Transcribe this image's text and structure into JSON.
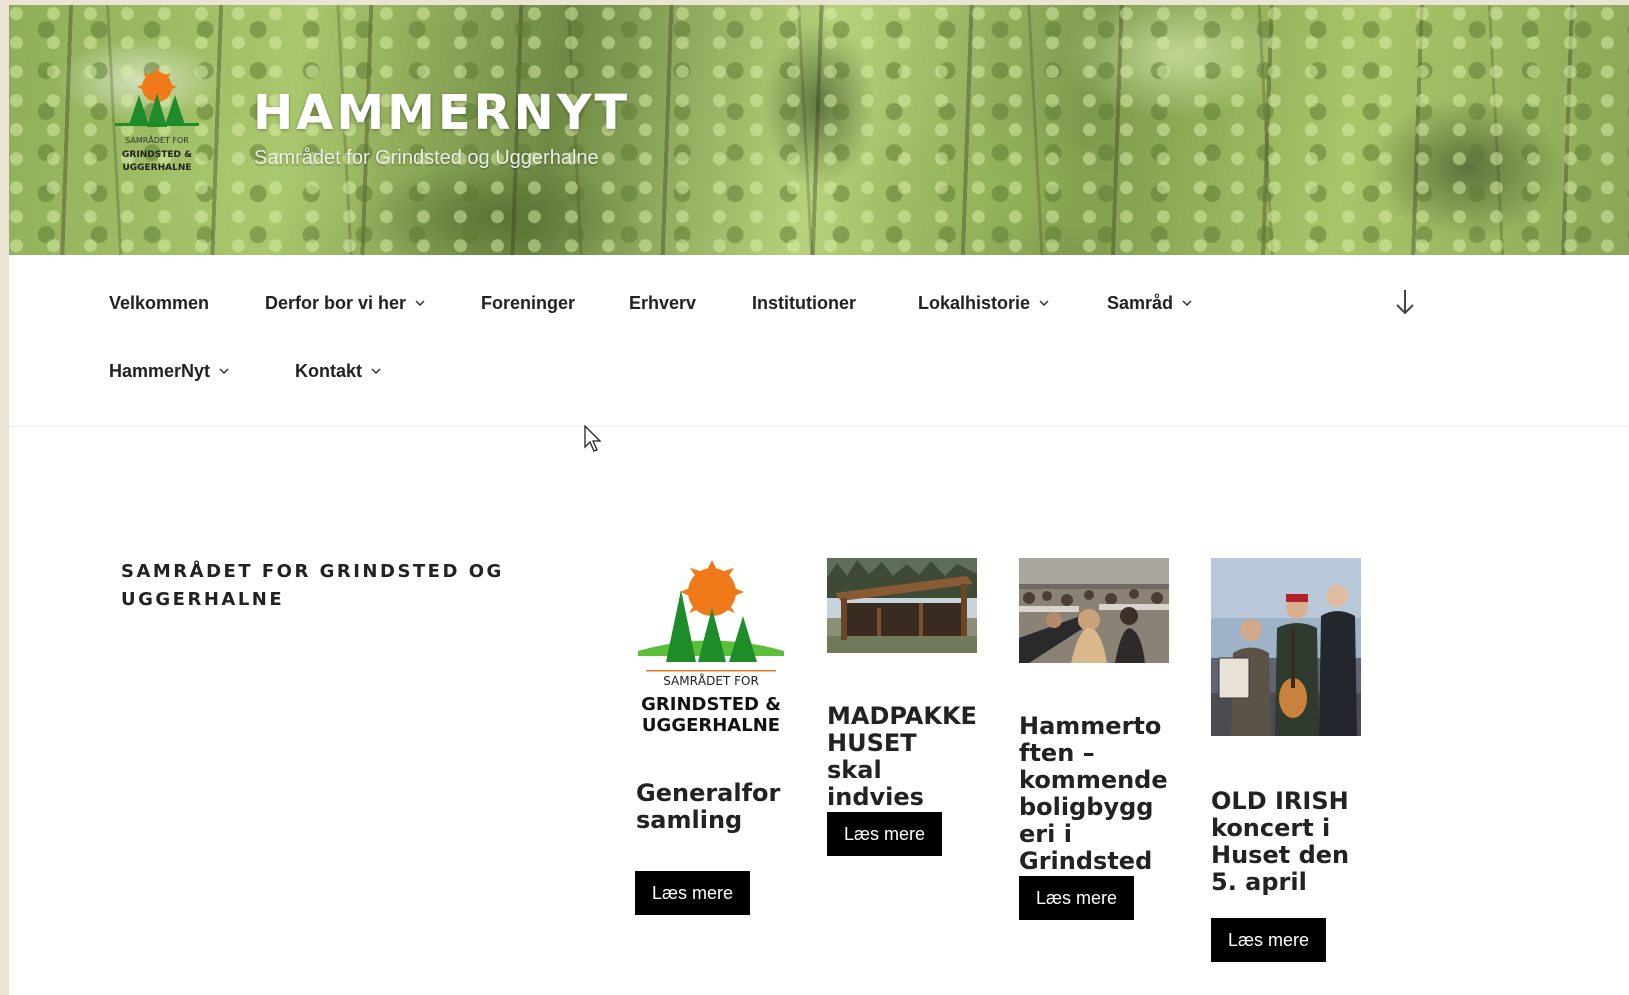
{
  "header": {
    "title": "HAMMERNYT",
    "tagline": "Samrådet for Grindsted og Uggerhalne",
    "logo_text": [
      "SAMRÅDET FOR",
      "GRINDSTED &",
      "UGGERHALNE"
    ]
  },
  "nav": {
    "items": [
      {
        "label": "Velkommen",
        "has_dropdown": false
      },
      {
        "label": "Derfor bor vi her",
        "has_dropdown": true
      },
      {
        "label": "Foreninger",
        "has_dropdown": false
      },
      {
        "label": "Erhverv",
        "has_dropdown": false
      },
      {
        "label": "Institutioner",
        "has_dropdown": false
      },
      {
        "label": "Lokalhistorie",
        "has_dropdown": true
      },
      {
        "label": "Samråd",
        "has_dropdown": true
      },
      {
        "label": "HammerNyt",
        "has_dropdown": true
      },
      {
        "label": "Kontakt",
        "has_dropdown": true
      }
    ],
    "scroll_icon": "arrow-down-icon"
  },
  "section": {
    "title": "SAMRÅDET FOR GRINDSTED OG UGGERHALNE"
  },
  "cards": [
    {
      "title": "Generalforsamling",
      "button": "Læs mere",
      "thumb": "samraad-logo"
    },
    {
      "title": "MADPAKKE HUSET skal indvies",
      "button": "Læs mere",
      "thumb": "shelter-photo"
    },
    {
      "title": "Hammertoften – kommende boligbyggeri i Grindsted",
      "button": "Læs mere",
      "thumb": "meeting-photo"
    },
    {
      "title": "OLD IRISH koncert i Huset den 5. april",
      "button": "Læs mere",
      "thumb": "musicians-photo"
    }
  ],
  "colors": {
    "accent_orange": "#f07a1a",
    "tree_green": "#1f8c2a",
    "button_bg": "#000000",
    "button_text": "#ffffff"
  }
}
